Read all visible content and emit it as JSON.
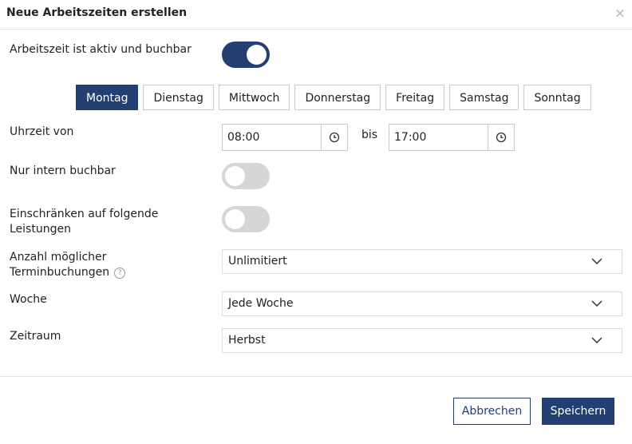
{
  "dialog": {
    "title": "Neue Arbeitszeiten erstellen",
    "close_symbol": "×"
  },
  "active_toggle": {
    "label": "Arbeitszeit ist aktiv und buchbar",
    "on": true
  },
  "days": [
    "Montag",
    "Dienstag",
    "Mittwoch",
    "Donnerstag",
    "Freitag",
    "Samstag",
    "Sonntag"
  ],
  "selected_day": "Montag",
  "time_range": {
    "label": "Uhrzeit von",
    "from": "08:00",
    "separator": "bis",
    "to": "17:00"
  },
  "internal_toggle": {
    "label": "Nur intern buchbar",
    "on": false
  },
  "restrict_toggle": {
    "label_line1": "Einschränken auf folgende",
    "label_line2": "Leistungen",
    "on": false
  },
  "bookings": {
    "label_line1": "Anzahl möglicher",
    "label_line2": "Terminbuchungen",
    "help_symbol": "?",
    "value": "Unlimitiert"
  },
  "week": {
    "label": "Woche",
    "value": "Jede Woche"
  },
  "period": {
    "label": "Zeitraum",
    "value": "Herbst"
  },
  "footer": {
    "cancel_label": "Abbrechen",
    "save_label": "Speichern"
  },
  "colors": {
    "primary": "#233f72",
    "toggle_off": "#d6d6d6",
    "border": "#c9c9c9"
  },
  "icons": {
    "time_picker": "clock-icon",
    "dropdown": "chevron-down-icon",
    "close": "close-icon",
    "help": "help-circle-icon"
  }
}
